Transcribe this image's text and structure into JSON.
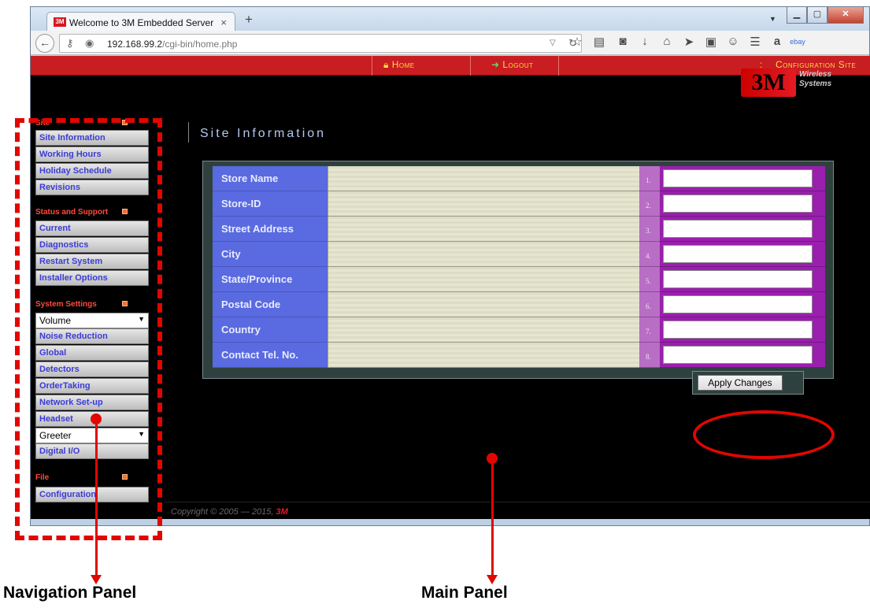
{
  "browser": {
    "tab_title": "Welcome to 3M Embedded Server",
    "url_host": "192.168.99.2",
    "url_path": "/cgi-bin/home.php"
  },
  "topnav": {
    "home": "Home",
    "logout": "Logout",
    "config_site": "Configuration Site",
    "sep": ":"
  },
  "logo": {
    "brand": "3M",
    "line1": "Wireless",
    "line2": "Systems"
  },
  "sidebar": {
    "site_header": "Site",
    "site_items": [
      "Site Information",
      "Working Hours",
      "Holiday Schedule",
      "Revisions"
    ],
    "status_header": "Status and Support",
    "status_items": [
      "Current",
      "Diagnostics",
      "Restart System",
      "Installer Options"
    ],
    "system_header": "System Settings",
    "select1": "Volume",
    "system_items": [
      "Noise Reduction",
      "Global",
      "Detectors",
      "OrderTaking",
      "Network Set-up",
      "Headset"
    ],
    "select2": "Greeter",
    "digital_io": "Digital I/O",
    "file_header": "File",
    "file_items": [
      "Configuration"
    ]
  },
  "main": {
    "title": "Site Information",
    "rows": [
      {
        "num": "1.",
        "label": "Store Name",
        "value": ""
      },
      {
        "num": "2.",
        "label": "Store-ID",
        "value": ""
      },
      {
        "num": "3.",
        "label": "Street Address",
        "value": ""
      },
      {
        "num": "4.",
        "label": "City",
        "value": ""
      },
      {
        "num": "5.",
        "label": "State/Province",
        "value": ""
      },
      {
        "num": "6.",
        "label": "Postal Code",
        "value": ""
      },
      {
        "num": "7.",
        "label": "Country",
        "value": ""
      },
      {
        "num": "8.",
        "label": "Contact Tel. No.",
        "value": ""
      }
    ],
    "apply": "Apply Changes"
  },
  "footer": {
    "copyright": "Copyright © 2005 — 2015,",
    "brand": "3M"
  },
  "annotations": {
    "nav_label": "Navigation Panel",
    "main_label": "Main Panel",
    "color": "#e10600"
  }
}
